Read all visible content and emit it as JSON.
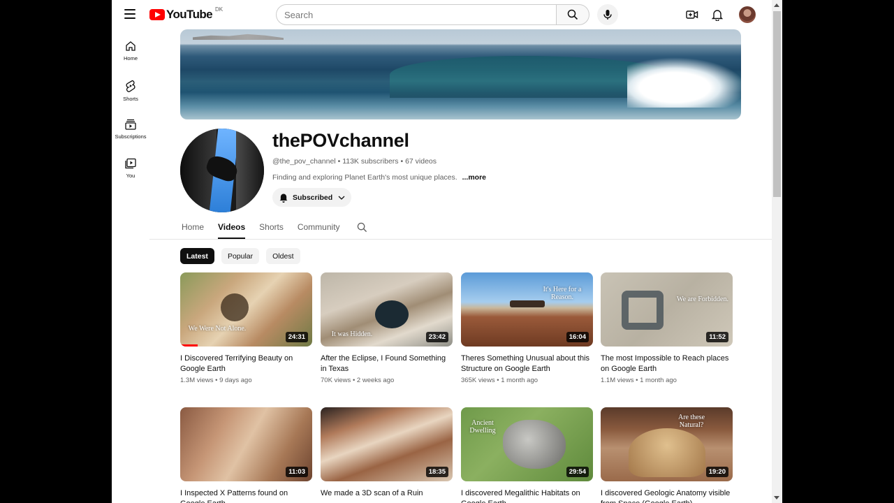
{
  "masthead": {
    "logo_text": "YouTube",
    "country_code": "DK",
    "search_placeholder": "Search"
  },
  "guide": {
    "items": [
      {
        "label": "Home",
        "icon": "home-icon"
      },
      {
        "label": "Shorts",
        "icon": "shorts-icon"
      },
      {
        "label": "Subscriptions",
        "icon": "subscriptions-icon"
      },
      {
        "label": "You",
        "icon": "you-icon"
      }
    ]
  },
  "channel": {
    "name": "thePOVchannel",
    "handle": "@the_pov_channel",
    "subscribers": "113K subscribers",
    "video_count": "67 videos",
    "separator": "•",
    "description": "Finding and exploring Planet Earth's most unique places.",
    "more_label": "...more",
    "subscribe_label": "Subscribed"
  },
  "tabs": [
    {
      "label": "Home",
      "active": false
    },
    {
      "label": "Videos",
      "active": true
    },
    {
      "label": "Shorts",
      "active": false
    },
    {
      "label": "Community",
      "active": false
    }
  ],
  "chips": [
    {
      "label": "Latest",
      "active": true
    },
    {
      "label": "Popular",
      "active": false
    },
    {
      "label": "Oldest",
      "active": false
    }
  ],
  "videos": [
    {
      "title": "I Discovered Terrifying Beauty on Google Earth",
      "views": "1.3M views",
      "age": "9 days ago",
      "duration": "24:31",
      "overlay": "We Were Not Alone.",
      "watched_fraction": 0.13
    },
    {
      "title": "After the Eclipse, I Found Something in Texas",
      "views": "70K views",
      "age": "2 weeks ago",
      "duration": "23:42",
      "overlay": "It was Hidden."
    },
    {
      "title": "Theres Something Unusual about this Structure on Google Earth",
      "views": "365K views",
      "age": "1 month ago",
      "duration": "16:04",
      "overlay": "It's Here for a Reason."
    },
    {
      "title": "The most Impossible to Reach places on Google Earth",
      "views": "1.1M views",
      "age": "1 month ago",
      "duration": "11:52",
      "overlay": "We are Forbidden."
    },
    {
      "title": "I Inspected X Patterns found on Google Earth",
      "views": "",
      "age": "",
      "duration": "11:03",
      "overlay": ""
    },
    {
      "title": "We made a 3D scan of a Ruin",
      "views": "",
      "age": "",
      "duration": "18:35",
      "overlay": ""
    },
    {
      "title": "I discovered Megalithic Habitats on Google Earth",
      "views": "",
      "age": "",
      "duration": "29:54",
      "overlay": "Ancient Dwelling"
    },
    {
      "title": "I discovered Geologic Anatomy visible from Space (Google Earth)",
      "views": "",
      "age": "",
      "duration": "19:20",
      "overlay": "Are these Natural?"
    }
  ],
  "meta_separator": "•"
}
